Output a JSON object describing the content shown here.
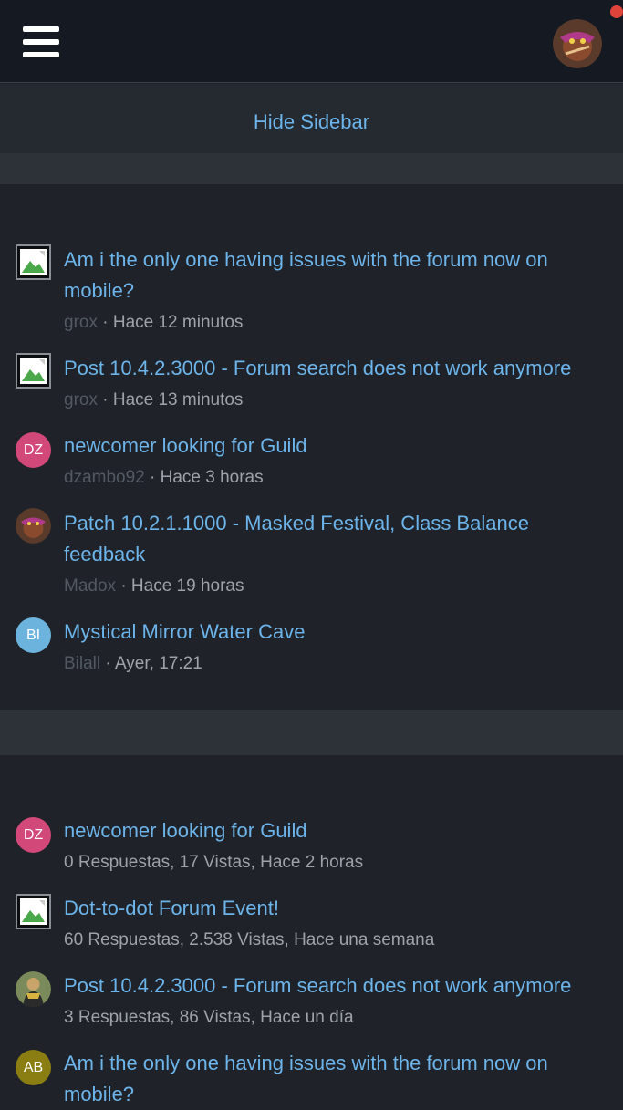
{
  "header": {
    "menu_icon": "hamburger-menu-icon",
    "avatar_icon": "user-avatar",
    "notification_color": "#e0433a"
  },
  "sidebar_toggle": {
    "label": "Hide Sidebar"
  },
  "recent_posts": [
    {
      "title": "Am i the only one having issues with the forum now on mobile?",
      "user": "grox",
      "time": "· Hace 12 minutos",
      "avatar": "broken-image"
    },
    {
      "title": "Post 10.4.2.3000 - Forum search does not work anymore",
      "user": "grox",
      "time": "· Hace 13 minutos",
      "avatar": "broken-image"
    },
    {
      "title": "newcomer looking for Guild",
      "user": "dzambo92",
      "time": "· Hace 3 horas",
      "avatar": "DZ",
      "avatar_color": "#d24878"
    },
    {
      "title": "Patch 10.2.1.1000 - Masked Festival, Class Balance feedback",
      "user": "Madox",
      "time": "· Hace 19 horas",
      "avatar": "image"
    },
    {
      "title": "Mystical Mirror Water Cave",
      "user": "Bilall",
      "time": "· Ayer, 17:21",
      "avatar": "BI",
      "avatar_color": "#6cb4dd"
    }
  ],
  "recent_threads": [
    {
      "title": "newcomer looking for Guild",
      "stats": "0 Respuestas, 17 Vistas, Hace 2 horas",
      "avatar": "DZ",
      "avatar_color": "#d24878"
    },
    {
      "title": "Dot-to-dot Forum Event!",
      "stats": "60 Respuestas, 2.538 Vistas, Hace una semana",
      "avatar": "broken-image"
    },
    {
      "title": "Post 10.4.2.3000 - Forum search does not work anymore",
      "stats": "3 Respuestas, 86 Vistas, Hace un día",
      "avatar": "image"
    },
    {
      "title": "Am i the only one having issues with the forum now on mobile?",
      "stats": "",
      "avatar": "AB",
      "avatar_color": "#8a7d12"
    }
  ]
}
